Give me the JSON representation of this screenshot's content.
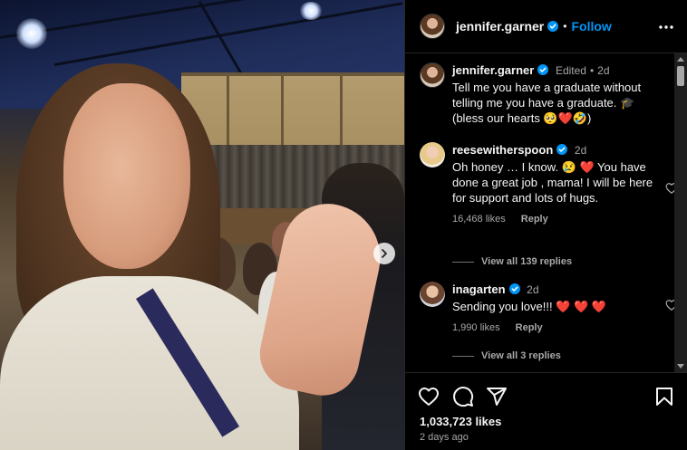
{
  "post": {
    "username": "jennifer.garner",
    "follow_label": "Follow",
    "separator": "•",
    "likes": "1,033,723 likes",
    "posted_ago": "2 days ago"
  },
  "caption": {
    "username": "jennifer.garner",
    "edited": "Edited",
    "time": "2d",
    "text": "Tell me you have a graduate without telling me you have a graduate. 🎓 (bless our hearts 🥺❤️🤣)"
  },
  "comments": [
    {
      "username": "reesewitherspoon",
      "time": "2d",
      "text": "Oh honey … I know. 😢 ❤️ You have done a great job , mama! I will be here for support and lots of hugs.",
      "likes": "16,468 likes",
      "reply_label": "Reply",
      "view_replies": "View all 139 replies"
    },
    {
      "username": "inagarten",
      "time": "2d",
      "text": "Sending you love!!! ❤️ ❤️ ❤️",
      "likes": "1,990 likes",
      "reply_label": "Reply",
      "view_replies": "View all 3 replies"
    }
  ],
  "icons": {
    "verified": "verified-badge-icon",
    "more": "more-options-icon",
    "next": "chevron-right-icon",
    "like": "heart-icon",
    "comment": "comment-icon",
    "share": "send-icon",
    "save": "bookmark-icon"
  },
  "colors": {
    "background": "#000000",
    "link_blue": "#0095f6",
    "verified_blue": "#0095f6",
    "muted_text": "#a8a8a8"
  }
}
